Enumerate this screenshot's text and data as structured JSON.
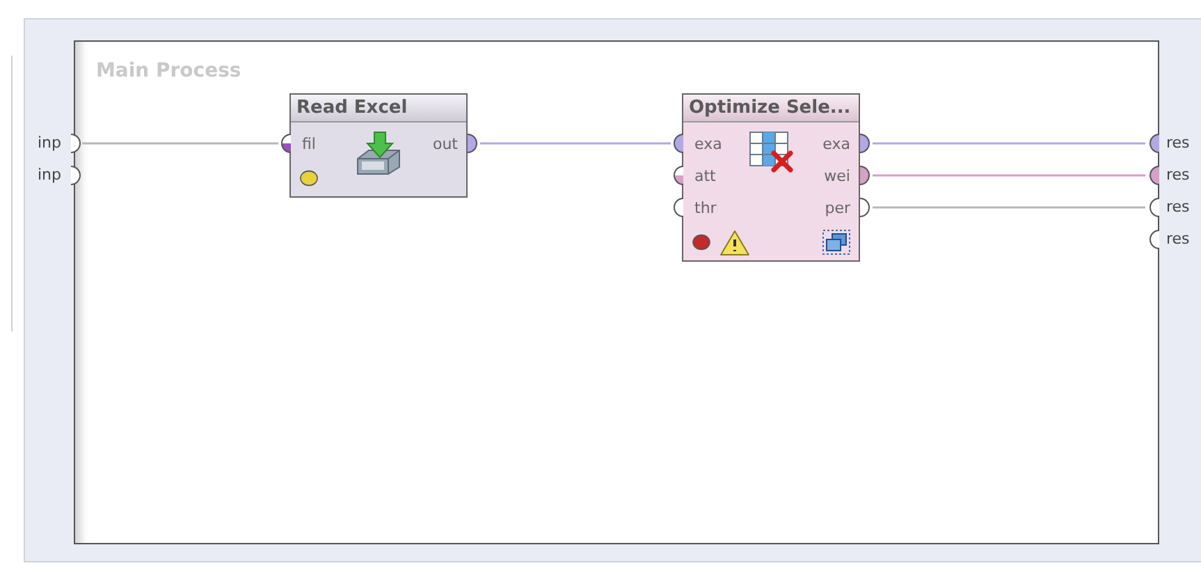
{
  "process": {
    "title": "Main Process",
    "inputs": [
      {
        "label": "inp"
      },
      {
        "label": "inp"
      }
    ],
    "outputs": [
      {
        "label": "res",
        "kind": "full",
        "color": "#b4a7e6"
      },
      {
        "label": "res",
        "kind": "full",
        "color": "#d7a0c8"
      },
      {
        "label": "res",
        "kind": "empty"
      },
      {
        "label": "res",
        "kind": "empty"
      }
    ]
  },
  "operators": [
    {
      "title": "Read Excel",
      "kind": "import",
      "error": false,
      "warning": false,
      "subprocess": false,
      "inputs": [
        {
          "label": "fil",
          "kind": "half",
          "color": "#9b4fc0"
        }
      ],
      "outputs": [
        {
          "label": "out",
          "kind": "full",
          "color": "#b4a7e6"
        }
      ]
    },
    {
      "title": "Optimize Sele...",
      "kind": "selection",
      "error": true,
      "warning": true,
      "subprocess": true,
      "inputs": [
        {
          "label": "exa",
          "kind": "full",
          "color": "#b4a7e6"
        },
        {
          "label": "att",
          "kind": "half",
          "color": "#d7a0c8"
        },
        {
          "label": "thr",
          "kind": "empty"
        }
      ],
      "outputs": [
        {
          "label": "exa",
          "kind": "full",
          "color": "#b4a7e6"
        },
        {
          "label": "wei",
          "kind": "full",
          "color": "#d7a0c8"
        },
        {
          "label": "per",
          "kind": "empty"
        }
      ]
    }
  ]
}
